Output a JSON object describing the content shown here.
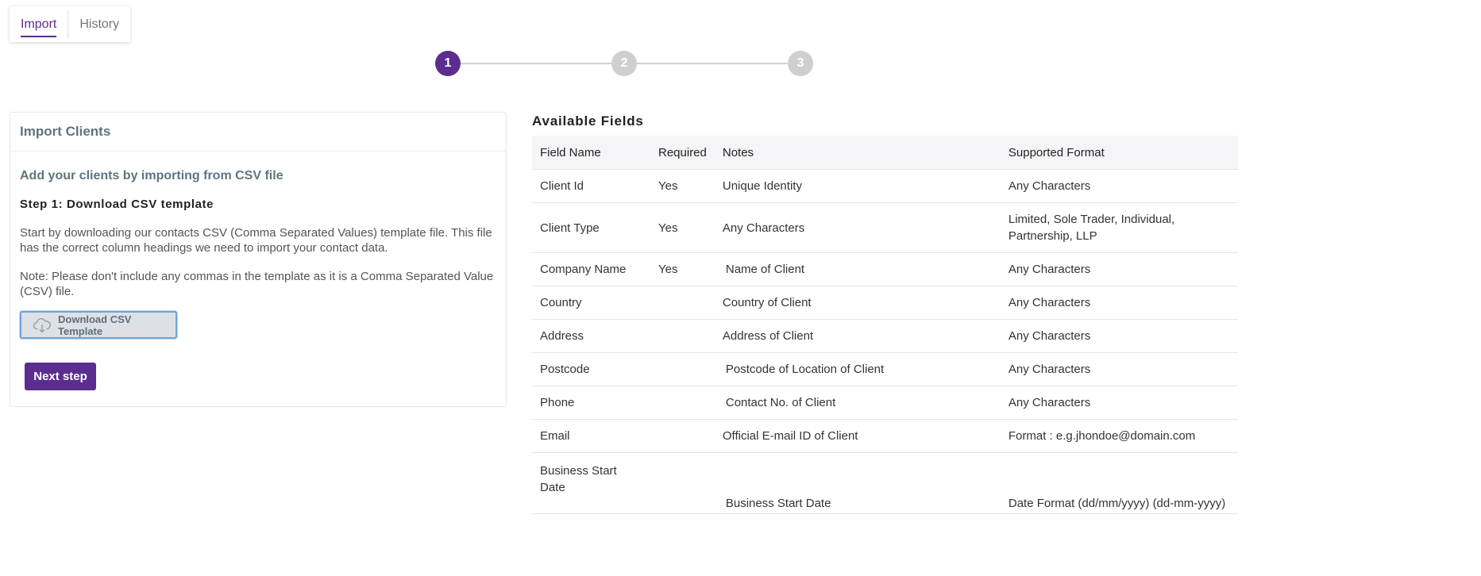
{
  "tabs": [
    {
      "label": "Import",
      "active": true
    },
    {
      "label": "History",
      "active": false
    }
  ],
  "stepper": {
    "steps": [
      "1",
      "2",
      "3"
    ],
    "current": 1
  },
  "import_card": {
    "title": "Import Clients",
    "subtitle": "Add your clients by importing from CSV file",
    "step_title": "Step 1: Download CSV template",
    "description": "Start by downloading our contacts CSV (Comma Separated Values) template file. This file has the correct column headings we need to import your contact data.",
    "note": "Note: Please don't include any commas in the template as it is a Comma Separated Value (CSV) file.",
    "download_button": "Download CSV Template",
    "download_icon": "cloud-download-icon",
    "next_button": "Next step"
  },
  "available_fields": {
    "title": "Available Fields",
    "columns": [
      "Field Name",
      "Required",
      "Notes",
      "Supported Format"
    ],
    "rows": [
      {
        "field": "Client Id",
        "required": "Yes",
        "notes": "Unique Identity",
        "format": "Any Characters"
      },
      {
        "field": "Client Type",
        "required": "Yes",
        "notes": "Any Characters",
        "format": "Limited, Sole Trader, Individual, Partnership, LLP"
      },
      {
        "field": "Company Name",
        "required": "Yes",
        "notes": "Name of Client",
        "format": "Any Characters"
      },
      {
        "field": "Country",
        "required": "",
        "notes": "Country of Client",
        "format": "Any Characters"
      },
      {
        "field": "Address",
        "required": "",
        "notes": "Address of Client",
        "format": "Any Characters"
      },
      {
        "field": "Postcode",
        "required": "",
        "notes": "Postcode of Location of Client",
        "format": "Any Characters"
      },
      {
        "field": "Phone",
        "required": "",
        "notes": "Contact No. of Client",
        "format": "Any Characters"
      },
      {
        "field": "Email",
        "required": "",
        "notes": "Official E-mail ID of Client",
        "format": "Format : e.g.jhondoe@domain.com"
      },
      {
        "field": "Business Start Date",
        "required": "",
        "notes": "Business Start Date",
        "format": "Date Format (dd/mm/yyyy) (dd-mm-yyyy)"
      }
    ]
  },
  "colors": {
    "accent": "#5b2d8e",
    "step_inactive": "#cfcfd3",
    "heading": "#5f7480"
  }
}
